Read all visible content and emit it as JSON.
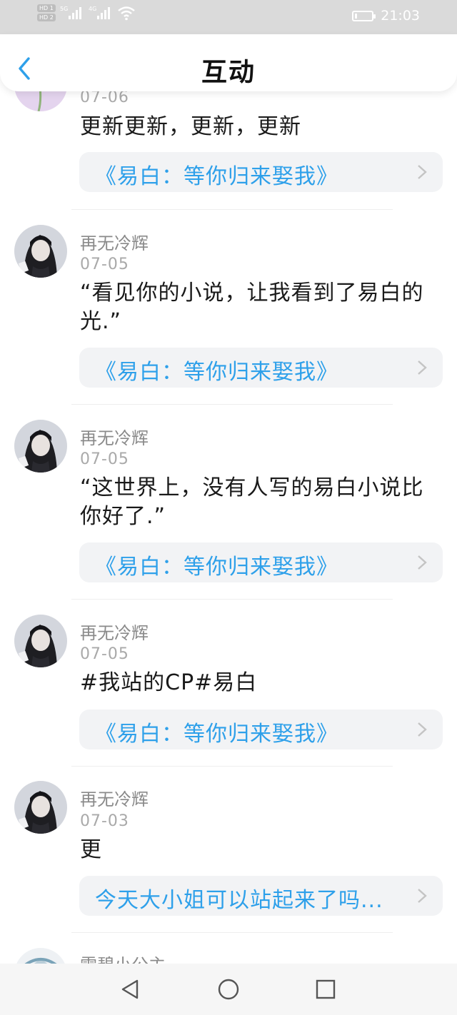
{
  "status_bar": {
    "hd1": "HD 1",
    "hd2": "HD 2",
    "signal1": "5G",
    "signal2": "4G",
    "time": "21:03",
    "battery_level_percent": 15
  },
  "header": {
    "title": "互动",
    "back_icon": "chevron-left-icon"
  },
  "items": [
    {
      "username": "",
      "date": "07-06",
      "text": "更新更新，更新，更新",
      "book": "《易白：等你归来娶我》"
    },
    {
      "username": "再无冷辉",
      "date": "07-05",
      "text": "“看见你的小说，让我看到了易白的光.”",
      "book": "《易白：等你归来娶我》"
    },
    {
      "username": "再无冷辉",
      "date": "07-05",
      "text": "“这世界上，没有人写的易白小说比你好了.”",
      "book": "《易白：等你归来娶我》"
    },
    {
      "username": "再无冷辉",
      "date": "07-05",
      "text": "#我站的CP#易白",
      "book": "《易白：等你归来娶我》"
    },
    {
      "username": "再无冷辉",
      "date": "07-03",
      "text": "更",
      "book": "今天大小姐可以站起来了吗..."
    },
    {
      "username": "雪碧小公主",
      "date": "",
      "text": "",
      "book": ""
    }
  ],
  "nav_bar": {
    "back": "triangle-back-icon",
    "home": "circle-home-icon",
    "recent": "square-recent-icon"
  },
  "colors": {
    "accent": "#2ea0ea",
    "status_bar_bg": "#dadada",
    "card_bg": "#f2f3f5"
  }
}
